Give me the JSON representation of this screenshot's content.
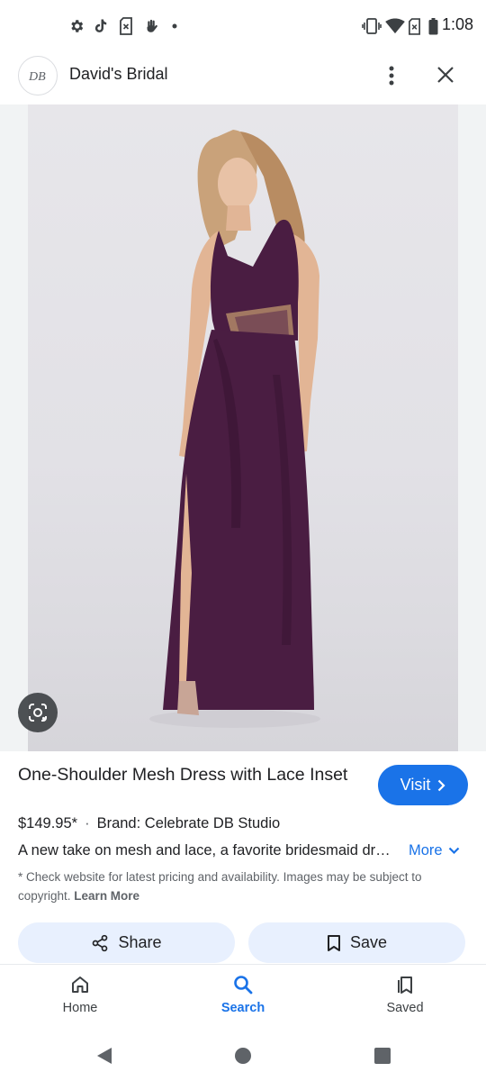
{
  "status_bar": {
    "time": "1:08",
    "left_icons": [
      "gear-icon",
      "tiktok-icon",
      "no-sim-icon",
      "hand-icon",
      "dot-icon"
    ],
    "right_icons": [
      "vibrate-icon",
      "wifi-icon",
      "no-sim-icon",
      "battery-icon"
    ]
  },
  "header": {
    "site_name": "David's Bridal",
    "menu_icon": "more-vert-icon",
    "close_icon": "close-icon"
  },
  "image": {
    "lens_icon": "google-lens-icon"
  },
  "product": {
    "title": "One-Shoulder Mesh Dress with Lace Inset",
    "price": "$149.95*",
    "separator": "·",
    "brand": "Brand: Celebrate DB Studio",
    "description": "A new take on mesh and lace, a favorite bridesmaid dress style.",
    "more_label": "More",
    "disclaimer": "* Check website for latest pricing and availability. Images may be subject to copyright.",
    "learn_more": "Learn More"
  },
  "actions": {
    "visit_label": "Visit",
    "share_label": "Share",
    "save_label": "Save"
  },
  "bottom_nav": {
    "items": [
      {
        "label": "Home",
        "icon": "home-icon"
      },
      {
        "label": "Search",
        "icon": "search-icon",
        "active": true
      },
      {
        "label": "Saved",
        "icon": "bookmarks-icon"
      }
    ]
  },
  "colors": {
    "accent": "#1a73e8",
    "button_tint": "#e8f0fe",
    "dress": "#4a1d42"
  }
}
